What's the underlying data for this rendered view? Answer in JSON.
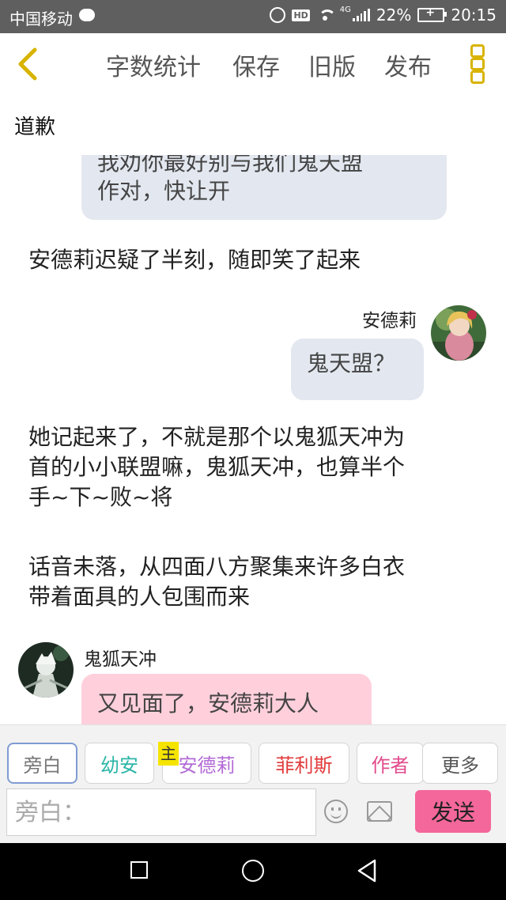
{
  "status_bar": {
    "carrier": "中国移动",
    "network": "4G",
    "battery": "22%",
    "time": "20:15"
  },
  "toolbar": {
    "word_count": "字数统计",
    "save": "保存",
    "old_version": "旧版",
    "publish": "发布"
  },
  "document": {
    "title": "道歉"
  },
  "messages": [
    {
      "type": "bubble",
      "side": "left",
      "text_line1": "我劝你最好别与我们鬼天盟",
      "text_line2": "作对，快让开"
    },
    {
      "type": "narration",
      "text": "安德莉迟疑了半刻，随即笑了起来"
    },
    {
      "type": "bubble",
      "side": "right",
      "speaker": "安德莉",
      "text": "鬼天盟？"
    },
    {
      "type": "narration",
      "line1": "她记起来了，不就是那个以鬼狐天冲为",
      "line2": "首的小小联盟嘛，鬼狐天冲，也算半个",
      "line3": "手~下~败~将"
    },
    {
      "type": "narration",
      "line1": "话音未落，从四面八方聚集来许多白衣",
      "line2": "带着面具的人包围而来"
    },
    {
      "type": "bubble",
      "side": "left",
      "speaker": "鬼狐天冲",
      "text": "又见面了，安德莉大人"
    }
  ],
  "role_tags": [
    {
      "label": "旁白",
      "selected": true,
      "color": "#777777"
    },
    {
      "label": "幼安",
      "color": "#2bb5a8"
    },
    {
      "label": "安德莉",
      "color": "#b36bd6",
      "badge": "主"
    },
    {
      "label": "菲利斯",
      "color": "#e23b3b"
    },
    {
      "label": "作者",
      "color": "#e24a8c"
    },
    {
      "label": "更多",
      "color": "#555555"
    }
  ],
  "input": {
    "placeholder": "旁白："
  },
  "send_label": "发送",
  "colors": {
    "send": "#f4679a",
    "accent": "#d8b300",
    "bubble_blue": "#e3e8f0",
    "bubble_pink": "#ffd0dc"
  },
  "icons": [
    "chat-bubble-icon",
    "alarm-icon",
    "hd-icon",
    "wifi-icon",
    "signal-icon",
    "battery-icon",
    "back-icon",
    "menu-icon",
    "emoji-icon",
    "image-icon",
    "nav-recent-icon",
    "nav-home-icon",
    "nav-back-icon"
  ]
}
